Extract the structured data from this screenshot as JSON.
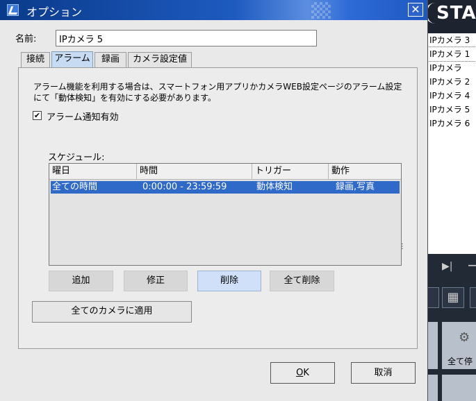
{
  "window": {
    "title": "オプション",
    "close_label": "✕"
  },
  "name_field": {
    "label": "名前:",
    "value": "IPカメラ 5"
  },
  "tabs": [
    {
      "label": "接続",
      "active": false
    },
    {
      "label": "アラーム",
      "active": true
    },
    {
      "label": "録画",
      "active": false
    },
    {
      "label": "カメラ設定値",
      "active": false
    }
  ],
  "alarm": {
    "description": "アラーム機能を利用する場合は、スマートフォン用アプリかカメラWEB設定ページのアラーム設定にて「動体検知」を有効にする必要があります。",
    "enable_checkbox": {
      "label": "アラーム通知有効",
      "checked": true,
      "mark": "✔"
    },
    "schedule_label": "スケジュール:",
    "columns": [
      "曜日",
      "時間",
      "トリガー",
      "動作"
    ],
    "rows": [
      {
        "day": "全ての時間",
        "time": "0:00:00 - 23:59:59",
        "trigger": "動体検知",
        "action": "録画,写真",
        "selected": true
      }
    ],
    "buttons": {
      "add": "追加",
      "edit": "修正",
      "delete": "削除",
      "delete_all": "全て削除"
    },
    "apply_all": "全てのカメラに適用"
  },
  "footer": {
    "ok": "OK",
    "ok_mnemonic": "O",
    "ok_rest": "K",
    "cancel": "取消"
  },
  "background_app": {
    "brand": "STA",
    "camera_list": [
      "IPカメラ 3",
      "IPカメラ 1",
      "IPカメラ",
      "IPカメラ 2",
      "IPカメラ 4",
      "IPカメラ 5",
      "IPカメラ 6"
    ],
    "stop_all": "全て停"
  },
  "colors": {
    "title_bar": "#1e5bc0",
    "selection": "#2f6ac8",
    "active_tab": "#c7dcf3"
  }
}
